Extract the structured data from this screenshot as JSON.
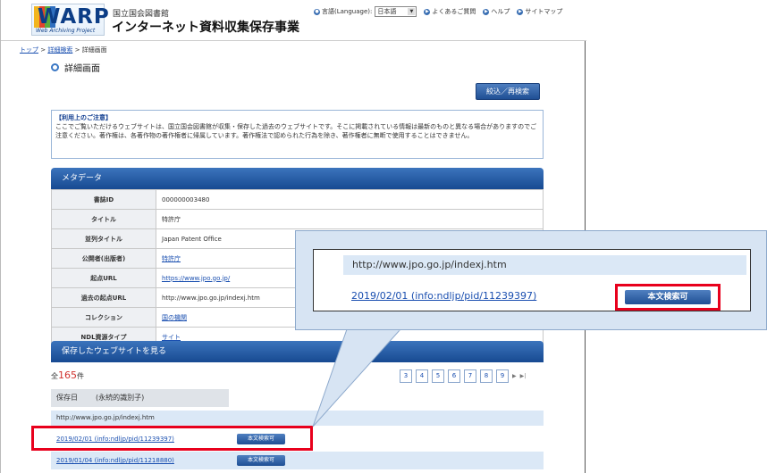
{
  "header": {
    "logo_text": "WARP",
    "logo_sub": "Web Archiving Project",
    "ndl_name": "国立国会図書館",
    "site_title": "インターネット資料収集保存事業",
    "lang_label": "言語(Language):",
    "lang_value": "日本語",
    "faq": "よくあるご質問",
    "help": "ヘルプ",
    "sitemap": "サイトマップ"
  },
  "breadcrumb": {
    "top": "トップ",
    "search": "詳細検索",
    "current": "詳細画面"
  },
  "page_title": "詳細画面",
  "refine_button": "絞込／再検索",
  "notice": {
    "heading": "【利用上のご注意】",
    "body": "ここでご覧いただけるウェブサイトは、国立国会図書館が収集・保存した過去のウェブサイトです。そこに掲載されている情報は最新のものと異なる場合がありますのでご注意ください。著作権は、各著作物の著作権者に帰属しています。著作権法で認められた行為を除き、著作権者に無断で使用することはできません。"
  },
  "metadata": {
    "section_title": "メタデータ",
    "rows": [
      {
        "key": "書誌ID",
        "value": "000000003480"
      },
      {
        "key": "タイトル",
        "value": "特許庁"
      },
      {
        "key": "並列タイトル",
        "value": "Japan Patent Office"
      },
      {
        "key": "公開者(出版者)",
        "value": "特許庁"
      },
      {
        "key": "起点URL",
        "value": "https://www.jpo.go.jp/"
      },
      {
        "key": "過去の起点URL",
        "value": "http://www.jpo.go.jp/indexj.htm"
      },
      {
        "key": "コレクション",
        "value": "国の機関"
      },
      {
        "key": "NDL資源タイプ",
        "value": "サイト"
      }
    ]
  },
  "saved": {
    "section_title": "保存したウェブサイトを見る",
    "total_prefix": "全",
    "total_count": "165",
    "total_suffix": "件",
    "pages": [
      "3",
      "4",
      "5",
      "6",
      "7",
      "8",
      "9"
    ],
    "col_date": "保存日",
    "col_id": "(永続的識別子)",
    "url": "http://www.jpo.go.jp/indexj.htm",
    "results": [
      {
        "label": "2019/02/01 (info:ndljp/pid/11239397)",
        "badge": "本文検索可"
      },
      {
        "label": "2019/01/04 (info:ndljp/pid/11218880)",
        "badge": "本文検索可"
      }
    ]
  },
  "callout": {
    "url": "http://www.jpo.go.jp/indexj.htm",
    "link": "2019/02/01 (info:ndljp/pid/11239397)",
    "badge": "本文検索可"
  }
}
